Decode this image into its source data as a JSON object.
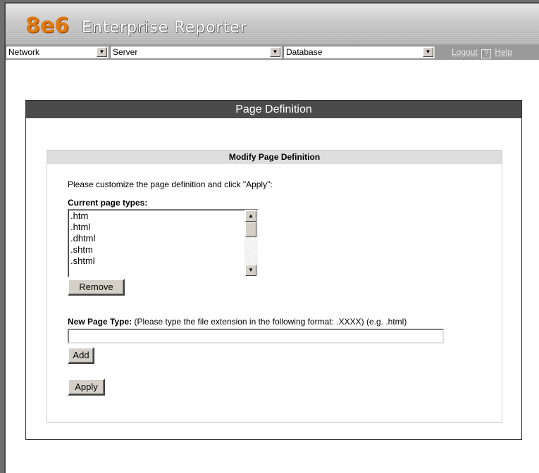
{
  "app": {
    "logo": "8e6",
    "product": "Enterprise Reporter"
  },
  "nav": {
    "network": "Network",
    "server": "Server",
    "database": "Database",
    "logout": "Logout",
    "help_icon_glyph": "?",
    "help": "Help"
  },
  "panel": {
    "title": "Page Definition"
  },
  "modify": {
    "title": "Modify Page Definition",
    "instructions": "Please customize the page definition and click \"Apply\":",
    "current_label": "Current page types:",
    "page_types": [
      ".htm",
      ".html",
      ".dhtml",
      ".shtm",
      ".shtml"
    ],
    "remove_label": "Remove",
    "new_label": "New Page Type:",
    "new_hint": "(Please type the file extension in the following format: .XXXX) (e.g. .html)",
    "new_value": "",
    "add_label": "Add",
    "apply_label": "Apply"
  }
}
